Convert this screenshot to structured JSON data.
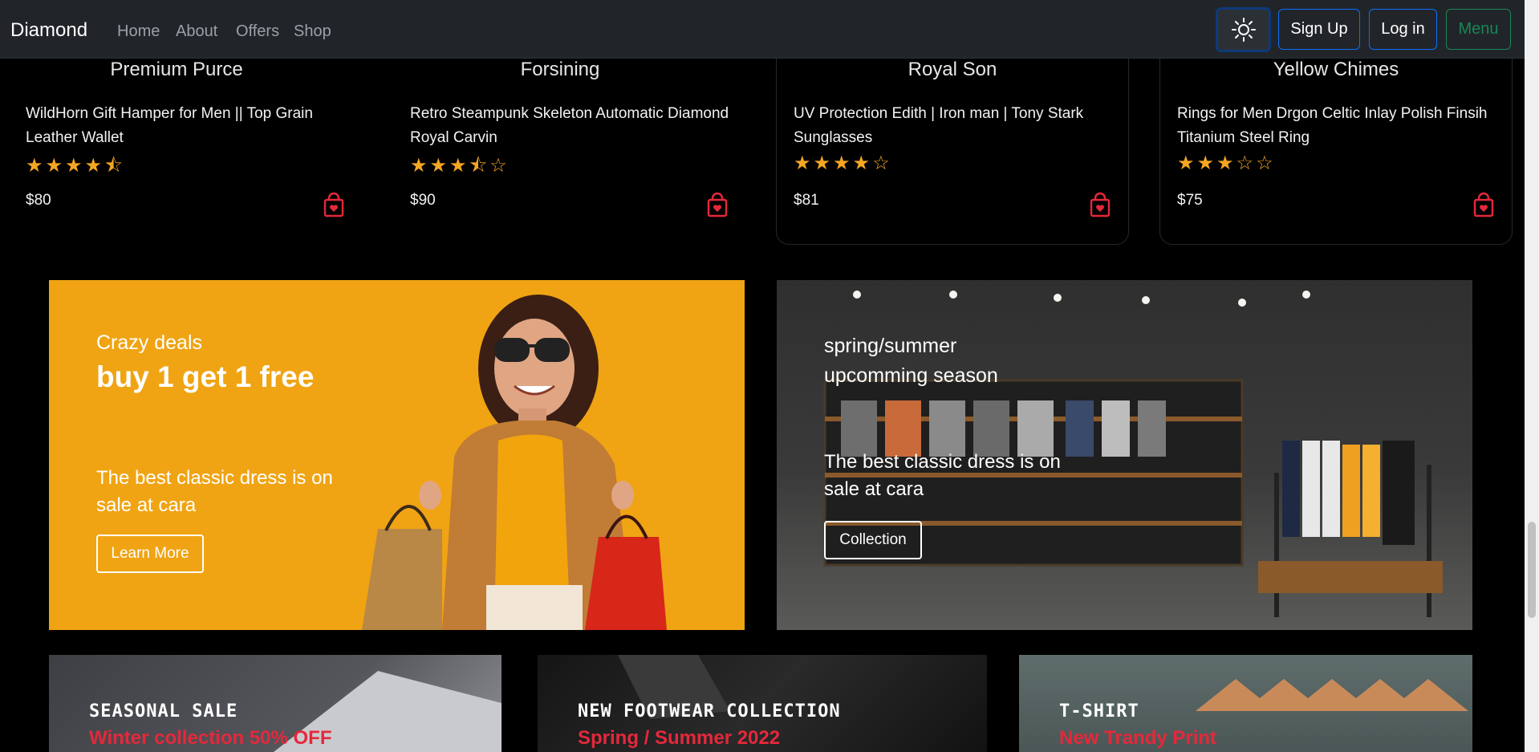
{
  "navbar": {
    "brand": "Diamond",
    "links": [
      "Home",
      "About",
      "Offers",
      "Shop"
    ],
    "signup": "Sign Up",
    "login": "Log in",
    "menu": "Menu"
  },
  "products": [
    {
      "brand": "Premium Purce",
      "title": "WildHorn Gift Hamper for Men || Top Grain Leather Wallet",
      "rating": 4.5,
      "stars": "★★★★⯪",
      "price": "$80"
    },
    {
      "brand": "Forsining",
      "title": "Retro Steampunk Skeleton Automatic Diamond Royal Carvin",
      "rating": 3.5,
      "stars": "★★★⯪☆",
      "price": "$90"
    },
    {
      "brand": "Royal Son",
      "title": "UV Protection Edith | Iron man | Tony Stark Sunglasses",
      "rating": 4,
      "stars": "★★★★☆",
      "price": "$81"
    },
    {
      "brand": "Yellow Chimes",
      "title": "Rings for Men Drgon Celtic Inlay Polish Finsih Titanium Steel Ring",
      "rating": 3,
      "stars": "★★★☆☆",
      "price": "$75"
    }
  ],
  "banners": {
    "left": {
      "small": "Crazy deals",
      "big": "buy 1 get 1 free",
      "desc": "The best classic dress is on sale at cara",
      "button": "Learn More"
    },
    "right": {
      "small": "spring/summer upcomming season",
      "desc": "The best classic dress is on sale at cara",
      "button": "Collection"
    }
  },
  "tiles": [
    {
      "heading": "SEASONAL SALE",
      "sub": "Winter collection 50% OFF"
    },
    {
      "heading": "NEW FOOTWEAR COLLECTION",
      "sub": "Spring / Summer 2022"
    },
    {
      "heading": "T-SHIRT",
      "sub": "New Trandy Print"
    }
  ],
  "colors": {
    "accent_red": "#e5283b",
    "star": "#f5a623",
    "banner_orange": "#f0a413",
    "nav_bg": "#212529"
  }
}
